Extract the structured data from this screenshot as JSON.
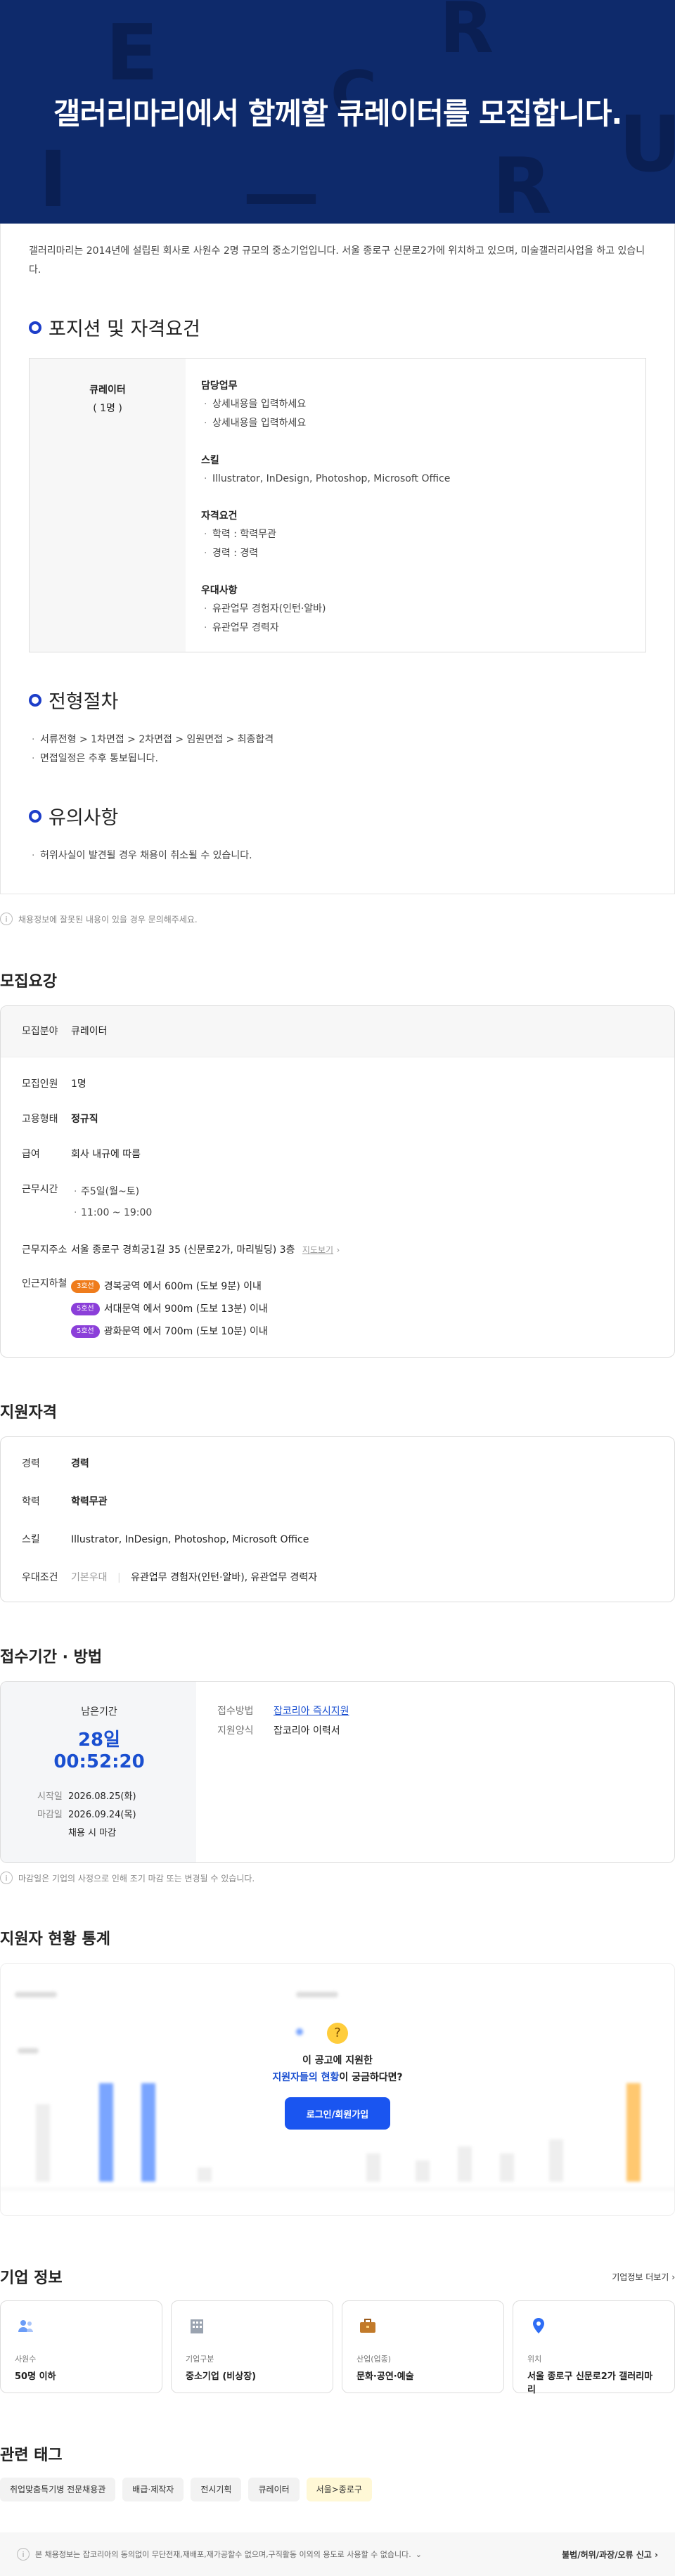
{
  "hero": {
    "title": "갤러리마리에서 함께할 큐레이터를 모집합니다.",
    "deco_letters": [
      "E",
      "R",
      "C",
      "U",
      "I",
      "R",
      "—"
    ]
  },
  "detail": {
    "intro": "갤러리마리는 2014년에 설립된 회사로 사원수 2명 규모의 중소기업입니다. 서울 종로구 신문로2가에 위치하고 있으며, 미술갤러리사업을 하고 있습니다.",
    "position_title": "포지션 및 자격요건",
    "position": {
      "name": "큐레이터",
      "count": "( 1명 )",
      "groups": [
        {
          "title": "담당업무",
          "items": [
            "상세내용을 입력하세요",
            "상세내용을 입력하세요"
          ]
        },
        {
          "title": "스킬",
          "items": [
            "Illustrator, InDesign, Photoshop, Microsoft Office"
          ]
        },
        {
          "title": "자격요건",
          "items": [
            "학력 : 학력무관",
            "경력 : 경력"
          ]
        },
        {
          "title": "우대사항",
          "items": [
            "유관업무 경험자(인턴·알바)",
            "유관업무 경력자"
          ]
        }
      ]
    },
    "process_title": "전형절차",
    "process_items": [
      "서류전형 > 1차면접 > 2차면접 > 임원면접 > 최종합격",
      "면접일정은 추후 통보됩니다."
    ],
    "caution_title": "유의사항",
    "caution_items": [
      "허위사실이 발견될 경우 채용이 취소될 수 있습니다."
    ]
  },
  "report_notice": "채용정보에 잘못된 내용이 있을 경우 문의해주세요.",
  "recruit": {
    "title": "모집요강",
    "field_label": "모집분야",
    "field_value": "큐레이터",
    "rows": [
      {
        "k": "모집인원",
        "v": "1명"
      },
      {
        "k": "고용형태",
        "v": "정규직"
      },
      {
        "k": "급여",
        "v": "회사 내규에 따름"
      },
      {
        "k": "근무시간",
        "v1": "주5일(월~토)",
        "v2": "11:00 ~ 19:00"
      },
      {
        "k": "근무지주소",
        "v": "서울 종로구 경희궁1길 35 (신문로2가, 마리빌딩) 3층",
        "link": "지도보기"
      },
      {
        "k": "인근지하철"
      }
    ],
    "subway": [
      {
        "line": "3호선",
        "color": "#ef7c1c",
        "text": "경복궁역 에서 600m (도보 9분) 이내"
      },
      {
        "line": "5호선",
        "color": "#8b3fd9",
        "text": "서대문역 에서 900m (도보 13분) 이내"
      },
      {
        "line": "5호선",
        "color": "#8b3fd9",
        "text": "광화문역 에서 700m (도보 10분) 이내"
      }
    ]
  },
  "qual": {
    "title": "지원자격",
    "career_k": "경력",
    "career_v": "경력",
    "edu_k": "학력",
    "edu_v": "학력무관",
    "skill_k": "스킬",
    "skill_v": "Illustrator, InDesign, Photoshop, Microsoft Office",
    "pref_k": "우대조건",
    "pref_tag": "기본우대",
    "pref_v": "유관업무 경험자(인턴·알바), 유관업무 경력자"
  },
  "apply": {
    "title": "접수기간 · 방법",
    "remain_label": "남은기간",
    "remain_value": "28일 00:52:20",
    "start_k": "시작일",
    "start_v": "2026.08.25(화)",
    "end_k": "마감일",
    "end_v": "2026.09.24(목)",
    "end_note": "채용 시 마감",
    "method_k": "접수방법",
    "method_v": "잡코리아 즉시지원",
    "form_k": "지원양식",
    "form_v": "잡코리아 이력서",
    "note": "마감일은 기업의 사정으로 인해 조기 마감 또는 변경될 수 있습니다."
  },
  "stats": {
    "title": "지원자 현황 통계",
    "prompt_line1": "이 공고에 지원한",
    "prompt_highlight": "지원자들의 현황",
    "prompt_line2": "이 궁금하다면?",
    "login_button": "로그인/회원가입"
  },
  "company": {
    "title": "기업 정보",
    "more": "기업정보 더보기",
    "cards": [
      {
        "label": "사원수",
        "value": "50명 이하",
        "icon": "people-icon"
      },
      {
        "label": "기업구분",
        "value": "중소기업 (비상장)",
        "icon": "building-icon"
      },
      {
        "label": "산업(업종)",
        "value": "문화·공연·예술",
        "icon": "briefcase-icon"
      },
      {
        "label": "위치",
        "value": "서울 종로구 신문로2가 갤러리마리",
        "icon": "location-icon"
      }
    ]
  },
  "tags": {
    "title": "관련 태그",
    "items": [
      "취업맞춤특기병 전문채용관",
      "배급·제작자",
      "전시기획",
      "큐레이터",
      "서울>종로구"
    ]
  },
  "footer": {
    "copyright": "본 채용정보는 잡코리아의 동의없이 무단전재,재배포,재가공할수 없으며,구직활동 이외의 용도로 사용할 수 없습니다.",
    "report": "불법/허위/과장/오류 신고"
  }
}
